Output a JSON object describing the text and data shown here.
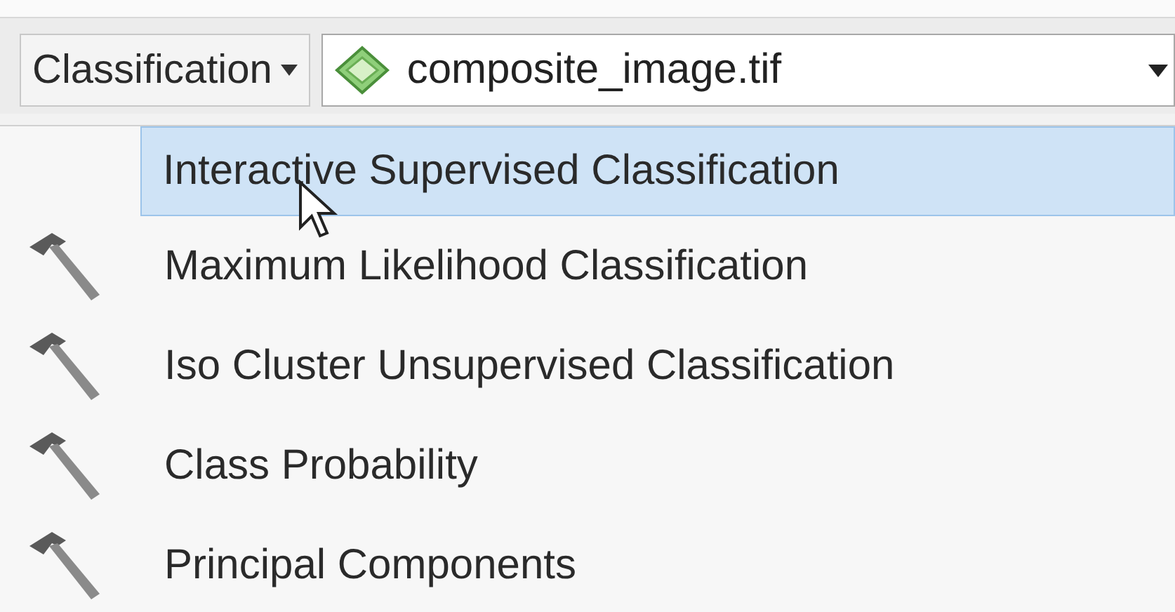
{
  "toolbar": {
    "menu_button": {
      "label": "Classification"
    },
    "layer_combo": {
      "value": "composite_image.tif"
    }
  },
  "menu": {
    "items": [
      {
        "label": "Interactive Supervised Classification",
        "selected": true,
        "kind": "plain"
      },
      {
        "label": "Maximum Likelihood Classification",
        "selected": false,
        "kind": "tool"
      },
      {
        "label": "Iso Cluster Unsupervised Classification",
        "selected": false,
        "kind": "tool"
      },
      {
        "label": "Class Probability",
        "selected": false,
        "kind": "tool"
      },
      {
        "label": "Principal Components",
        "selected": false,
        "kind": "tool"
      }
    ]
  }
}
